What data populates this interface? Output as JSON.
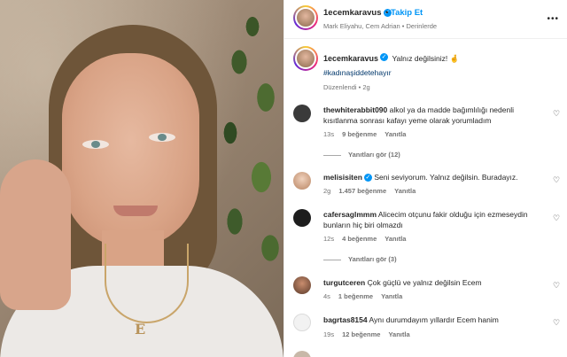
{
  "post": {
    "username": "1ecemkaravus",
    "follow_label": "Takip Et",
    "separator": "•",
    "location_line": "Mark Eliyahu, Cem Adrian  •  Derinlerde",
    "more_glyph": "•••"
  },
  "caption": {
    "username": "1ecemkaravus",
    "text": "Yalnız değilsiniz! 🤞",
    "hashtag": "#kadınaşiddetehayır",
    "edited": "Düzenlendi  •  2g"
  },
  "comments": [
    {
      "username": "thewhiterabbit090",
      "text": "alkol ya da madde bağımlılığı nedenli kısıtlanma sonrası kafayı yeme olarak yorumladım",
      "time": "13s",
      "likes": "9 beğenme",
      "reply": "Yanıtla",
      "view_replies": "Yanıtları gör (12)"
    },
    {
      "username": "melisisiten",
      "verified": true,
      "text": "Seni seviyorum. Yalnız değilsin. Buradayız.",
      "time": "2g",
      "likes": "1.457 beğenme",
      "reply": "Yanıtla"
    },
    {
      "username": "cafersaglmmm",
      "text": "Alicecim otçunu fakir olduğu için ezmeseydin bunların hiç biri olmazdı",
      "time": "12s",
      "likes": "4 beğenme",
      "reply": "Yanıtla",
      "view_replies": "Yanıtları gör (3)"
    },
    {
      "username": "turgutceren",
      "text": "Çok güçlü ve yalnız değilsin Ecem",
      "time": "4s",
      "likes": "1 beğenme",
      "reply": "Yanıtla"
    },
    {
      "username": "bagrtas8154",
      "text": "Aynı durumdayım yıllardır Ecem hanim",
      "time": "19s",
      "likes": "12 beğenme",
      "reply": "Yanıtla"
    }
  ],
  "icons": {
    "heart": "heart-outline-icon",
    "verified": "verified-badge-icon"
  },
  "colors": {
    "link_blue": "#0095f6",
    "hashtag": "#00376b",
    "muted": "#737373"
  }
}
